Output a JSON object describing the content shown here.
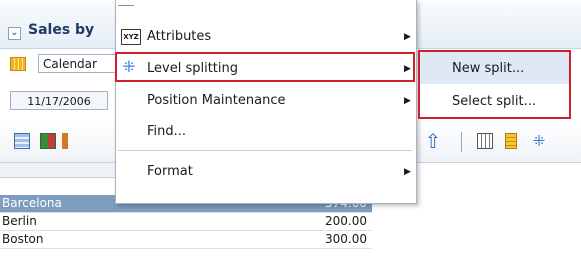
{
  "panel": {
    "collapse_glyph": "⌄",
    "title": "Sales by",
    "calendar_value": "Calendar",
    "date_value": "11/17/2006"
  },
  "table": {
    "rows": [
      {
        "city": "Barcelona",
        "value": "574.00"
      },
      {
        "city": "Berlin",
        "value": "200.00"
      },
      {
        "city": "Boston",
        "value": "300.00"
      }
    ]
  },
  "toolbar": {
    "up_arrow_glyph": "⇧",
    "split_glyph": "⁜"
  },
  "context_menu": {
    "xyz_icon_text": "XYZ",
    "split_icon_glyph": "⁜",
    "submenu_arrow": "▶",
    "items": [
      {
        "label": "Attributes"
      },
      {
        "label": "Level splitting"
      },
      {
        "label": "Position Maintenance"
      },
      {
        "label": "Find..."
      },
      {
        "label": "Format"
      }
    ]
  },
  "submenu": {
    "items": [
      {
        "label": "New split..."
      },
      {
        "label": "Select split..."
      }
    ]
  },
  "colors": {
    "highlight_border": "#d0212a",
    "selected_row": "#7e9cc0",
    "submenu_hover": "#dfe9f6"
  }
}
